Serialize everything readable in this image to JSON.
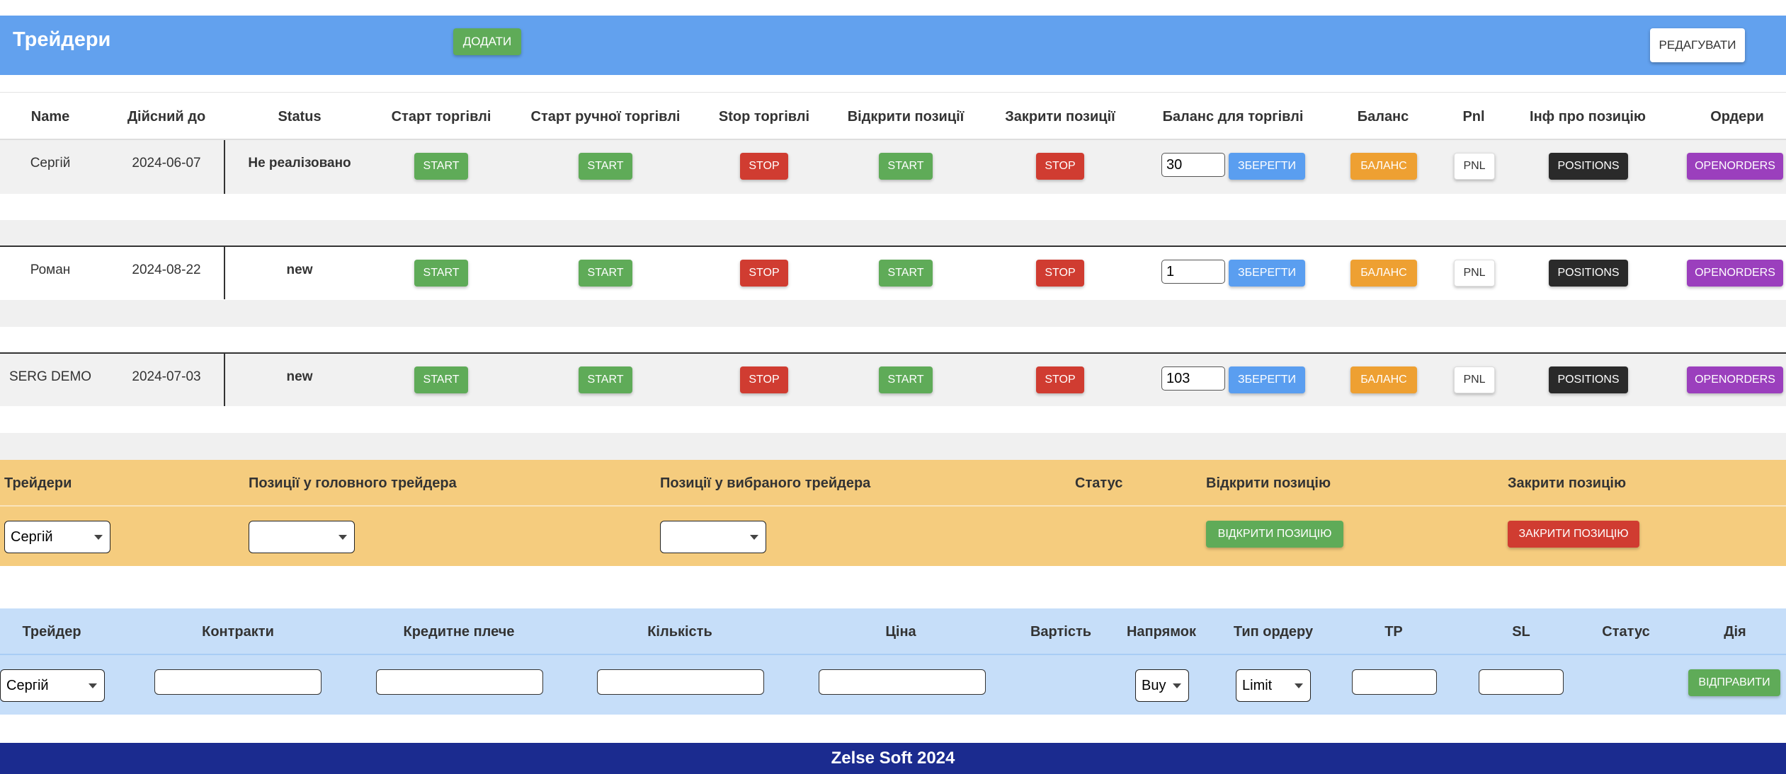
{
  "header": {
    "title": "Трейдери",
    "add_label": "ДОДАТИ",
    "edit_label": "РЕДАГУВАТИ"
  },
  "traders_table": {
    "columns": [
      "Name",
      "Дійсний до",
      "Status",
      "Старт торгівлі",
      "Старт ручної торгівлі",
      "Stop торгівлі",
      "Відкрити позиції",
      "Закрити позиції",
      "Баланс для торгівлі",
      "Баланс",
      "Pnl",
      "Інф про позицію",
      "Ордери"
    ],
    "rows": [
      {
        "name": "Сергій",
        "valid_until": "2024-06-07",
        "status": "Не реалізовано",
        "start": "START",
        "manual_start": "START",
        "stop": "STOP",
        "open_positions": "START",
        "close_positions": "STOP",
        "balance_value": "30",
        "save": "ЗБЕРЕГТИ",
        "balance": "БАЛАНС",
        "pnl": "PNL",
        "positions": "POSITIONS",
        "orders": "OPENORDERS"
      },
      {
        "name": "Роман",
        "valid_until": "2024-08-22",
        "status": "new",
        "start": "START",
        "manual_start": "START",
        "stop": "STOP",
        "open_positions": "START",
        "close_positions": "STOP",
        "balance_value": "1",
        "save": "ЗБЕРЕГТИ",
        "balance": "БАЛАНС",
        "pnl": "PNL",
        "positions": "POSITIONS",
        "orders": "OPENORDERS"
      },
      {
        "name": "SERG DEMO",
        "valid_until": "2024-07-03",
        "status": "new",
        "start": "START",
        "manual_start": "START",
        "stop": "STOP",
        "open_positions": "START",
        "close_positions": "STOP",
        "balance_value": "103",
        "save": "ЗБЕРЕГТИ",
        "balance": "БАЛАНС",
        "pnl": "PNL",
        "positions": "POSITIONS",
        "orders": "OPENORDERS"
      }
    ]
  },
  "positions_panel": {
    "columns": [
      "Трейдери",
      "Позиції у головного трейдера",
      "Позиції у вибраного трейдера",
      "Статус",
      "Відкрити позицію",
      "Закрити позицію"
    ],
    "trader_select": "Сергій",
    "main_positions_select": "",
    "selected_positions_select": "",
    "open_position_label": "ВІДКРИТИ ПОЗИЦІЮ",
    "close_position_label": "ЗАКРИТИ ПОЗИЦІЮ"
  },
  "order_panel": {
    "columns": [
      "Трейдер",
      "Контракти",
      "Кредитне плече",
      "Кількість",
      "Ціна",
      "Вартість",
      "Напрямок",
      "Тип ордеру",
      "TP",
      "SL",
      "Статус",
      "Дія"
    ],
    "trader_select": "Сергій",
    "direction_select": "Buy",
    "order_type_select": "Limit",
    "send_label": "ВІДПРАВИТИ"
  },
  "footer": {
    "text": "Zelse Soft 2024"
  },
  "colors": {
    "header_bg": "#62a1ee",
    "green": "#5fab58",
    "red": "#d03c31",
    "blue": "#5a9ef0",
    "orange": "#eea032",
    "purple": "#9b3fbd",
    "dark": "#2a2a2a",
    "positions_bg": "#f5cc7e",
    "order_bg": "#c6def9",
    "footer_bg": "#1b2b8f"
  }
}
